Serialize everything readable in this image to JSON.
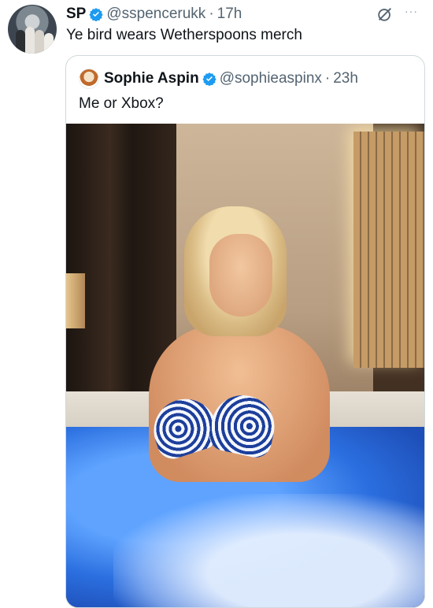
{
  "tweet": {
    "author_name": "SP",
    "author_handle": "@sspencerukk",
    "separator": "·",
    "time": "17h",
    "text": "Ye bird wears Wetherspoons merch",
    "more_label": "···"
  },
  "quoted_tweet": {
    "author_name": "Sophie Aspin",
    "author_handle": "@sophieaspinx",
    "separator": "·",
    "time": "23h",
    "text": "Me or Xbox?"
  },
  "colors": {
    "verified": "#1d9bf0",
    "text_primary": "#0f1419",
    "text_secondary": "#536471",
    "border": "#cfd9de"
  },
  "icons": {
    "verified": "verified-badge-icon",
    "grok": "grok-icon",
    "more": "more-icon"
  }
}
